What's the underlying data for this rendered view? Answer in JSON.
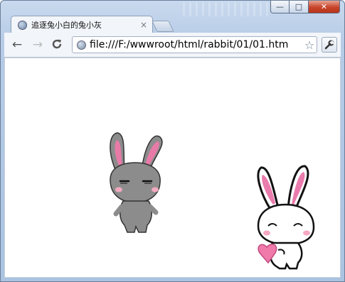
{
  "window": {
    "controls": {
      "minimize": "—",
      "maximize": "□",
      "close": "✕"
    }
  },
  "tab": {
    "title": "追逐兔小白的兔小灰",
    "close": "×",
    "favicon": "globe-icon"
  },
  "toolbar": {
    "back": "←",
    "forward": "→",
    "reload": "C",
    "url": "file:///F:/wwwroot/html/rabbit/01/01.htm",
    "star": "☆",
    "wrench": "🔧"
  },
  "page": {
    "characters": [
      {
        "name": "grey-bunny",
        "color": "#8c8c8c",
        "ear_inner": "#e87aa8"
      },
      {
        "name": "white-bunny",
        "color": "#ffffff",
        "ear_inner": "#ea7cad",
        "heart": "#f07aa9"
      }
    ]
  }
}
